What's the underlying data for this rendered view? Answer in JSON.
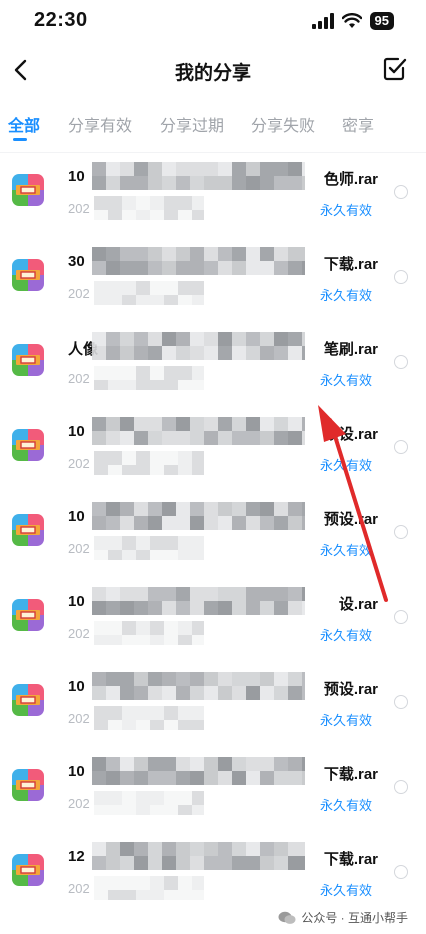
{
  "status_bar": {
    "time": "22:30",
    "battery": "95"
  },
  "nav": {
    "title": "我的分享"
  },
  "tabs": [
    {
      "label": "全部",
      "active": true
    },
    {
      "label": "分享有效",
      "active": false
    },
    {
      "label": "分享过期",
      "active": false
    },
    {
      "label": "分享失败",
      "active": false
    },
    {
      "label": "密享",
      "active": false
    }
  ],
  "files": [
    {
      "prefix": "10",
      "suffix": "色师.rar",
      "date": "202",
      "status": "永久有效"
    },
    {
      "prefix": "30",
      "suffix": "下载.rar",
      "date": "202",
      "status": "永久有效"
    },
    {
      "prefix": "人像",
      "suffix": "笔刷.rar",
      "date": "202",
      "status": "永久有效"
    },
    {
      "prefix": "10",
      "suffix": "预设.rar",
      "date": "202",
      "status": "永久有效"
    },
    {
      "prefix": "10",
      "suffix": "预设.rar",
      "date": "202",
      "status": "永久有效"
    },
    {
      "prefix": "10",
      "suffix": "设.rar",
      "date": "202",
      "status": "永久有效"
    },
    {
      "prefix": "10",
      "suffix": "预设.rar",
      "date": "202",
      "status": "永久有效"
    },
    {
      "prefix": "10",
      "suffix": "下载.rar",
      "date": "202",
      "status": "永久有效"
    },
    {
      "prefix": "12",
      "suffix": "下载.rar",
      "date": "202",
      "status": "永久有效"
    }
  ],
  "watermark": {
    "text": "公众号 · 互通小帮手"
  },
  "colors": {
    "accent": "#1a8fff",
    "annotation_arrow": "#e02a2a"
  },
  "icons": {
    "back": "chevron-left-icon",
    "select": "checkbox-icon",
    "file": "rar-archive-icon"
  }
}
